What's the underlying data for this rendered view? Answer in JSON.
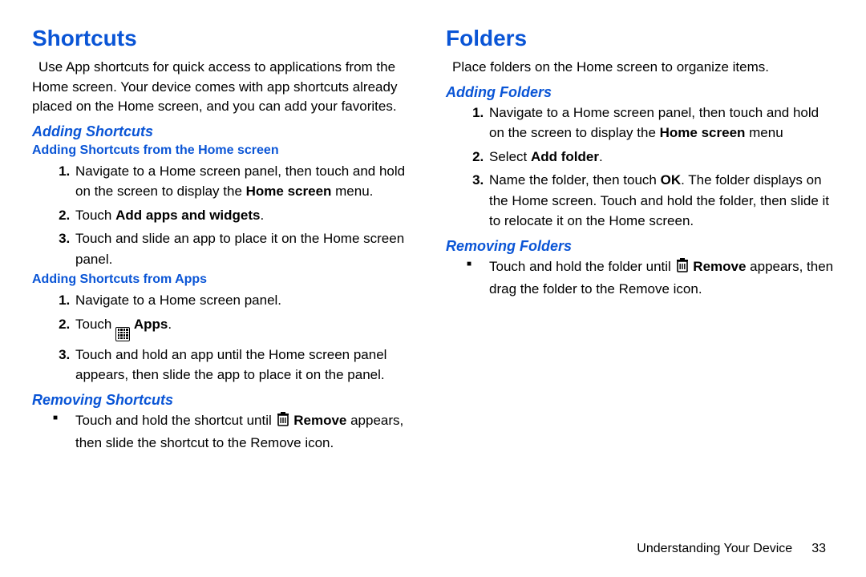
{
  "left": {
    "title": "Shortcuts",
    "intro": "Use App shortcuts for quick access to applications from the Home screen. Your device comes with app shortcuts already placed on the Home screen, and you can add your favorites.",
    "adding": {
      "heading": "Adding Shortcuts",
      "home": {
        "heading": "Adding Shortcuts from the Home screen",
        "s1a": "Navigate to a Home screen panel, then touch and hold on the screen to display the ",
        "s1b": "Home screen",
        "s1c": " menu.",
        "s2a": "Touch ",
        "s2b": "Add apps and widgets",
        "s2c": ".",
        "s3": "Touch and slide an app to place it on the Home screen panel."
      },
      "apps": {
        "heading": "Adding Shortcuts from Apps",
        "s1": "Navigate to a Home screen panel.",
        "s2a": "Touch ",
        "s2b": "Apps",
        "s2c": ".",
        "s3": "Touch and hold an app until the Home screen panel appears, then slide the app to place it on the panel."
      }
    },
    "removing": {
      "heading": "Removing Shortcuts",
      "b1a": "Touch and hold the shortcut until ",
      "b1b": "Remove",
      "b1c": " appears, then slide the shortcut to the Remove icon."
    }
  },
  "right": {
    "title": "Folders",
    "intro": "Place folders on the Home screen to organize items.",
    "adding": {
      "heading": "Adding Folders",
      "s1a": "Navigate to a Home screen panel, then touch and hold on the screen to display the ",
      "s1b": "Home screen",
      "s1c": " menu",
      "s2a": "Select ",
      "s2b": "Add folder",
      "s2c": ".",
      "s3a": "Name the folder, then touch ",
      "s3b": "OK",
      "s3c": ". The folder displays on the Home screen. Touch and hold the folder, then slide it to relocate it on the Home screen."
    },
    "removing": {
      "heading": "Removing Folders",
      "b1a": "Touch and hold the folder until ",
      "b1b": "Remove",
      "b1c": " appears, then drag the folder to the Remove icon."
    }
  },
  "footer": {
    "section": "Understanding Your Device",
    "page": "33"
  }
}
